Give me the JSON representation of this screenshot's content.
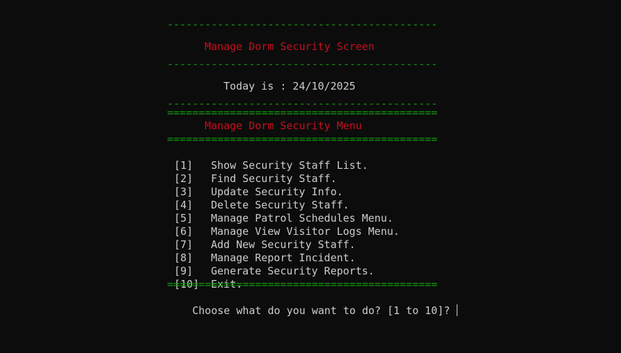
{
  "screen": {
    "dash_line": "-------------------------------------------",
    "title": "Manage Dorm Security Screen",
    "date_line": "Today is : 24/10/2025"
  },
  "menu": {
    "double_line": "===========================================",
    "title": "Manage Dorm Security Menu",
    "items": [
      {
        "num": "[1]",
        "label": "Show Security Staff List."
      },
      {
        "num": "[2]",
        "label": "Find Security Staff."
      },
      {
        "num": "[3]",
        "label": "Update Security Info."
      },
      {
        "num": "[4]",
        "label": "Delete Security Staff."
      },
      {
        "num": "[5]",
        "label": "Manage Patrol Schedules Menu."
      },
      {
        "num": "[6]",
        "label": "Manage View Visitor Logs Menu."
      },
      {
        "num": "[7]",
        "label": "Add New Security Staff."
      },
      {
        "num": "[8]",
        "label": "Manage Report Incident."
      },
      {
        "num": "[9]",
        "label": "Generate Security Reports."
      },
      {
        "num": "[10]",
        "label": "Exit."
      }
    ]
  },
  "prompt": {
    "text": "Choose what do you want to do? [1 to 10]? "
  },
  "colors": {
    "background": "#0c0c0c",
    "separator": "#13a10e",
    "heading": "#c50f1f",
    "text": "#cccccc"
  }
}
